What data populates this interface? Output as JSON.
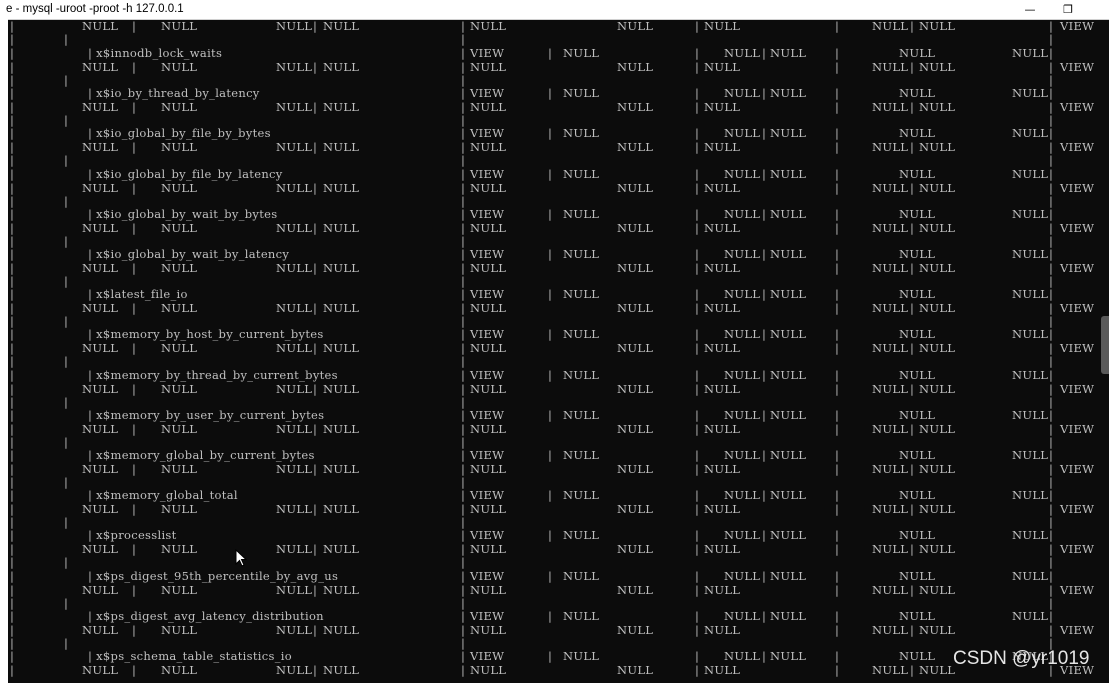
{
  "window": {
    "title": "e - mysql  -uroot -proot -h 127.0.0.1",
    "minimize_icon": "minimize-icon",
    "minimize_glyph": "—",
    "restore_icon": "restore-icon",
    "restore_glyph": "❐"
  },
  "terminal": {
    "null": "NULL",
    "view": "VIEW",
    "sep": "|",
    "first_row_fragment": {
      "cells_row1": [
        "NULL",
        "NULL",
        "NULL",
        "|",
        "NULL",
        "|",
        "NULL",
        "NULL",
        "NULL",
        "NULL",
        "|",
        "NULL",
        "|",
        "VIEW"
      ]
    },
    "table_names": [
      "x$innodb_lock_waits",
      "x$io_by_thread_by_latency",
      "x$io_global_by_file_by_bytes",
      "x$io_global_by_file_by_latency",
      "x$io_global_by_wait_by_bytes",
      "x$io_global_by_wait_by_latency",
      "x$latest_file_io",
      "x$memory_by_host_by_current_bytes",
      "x$memory_by_thread_by_current_bytes",
      "x$memory_by_user_by_current_bytes",
      "x$memory_global_by_current_bytes",
      "x$memory_global_total",
      "x$processlist",
      "x$ps_digest_95th_percentile_by_avg_us",
      "x$ps_digest_avg_latency_distribution",
      "x$ps_schema_table_statistics_io"
    ]
  },
  "watermark": "CSDN @yr1019"
}
